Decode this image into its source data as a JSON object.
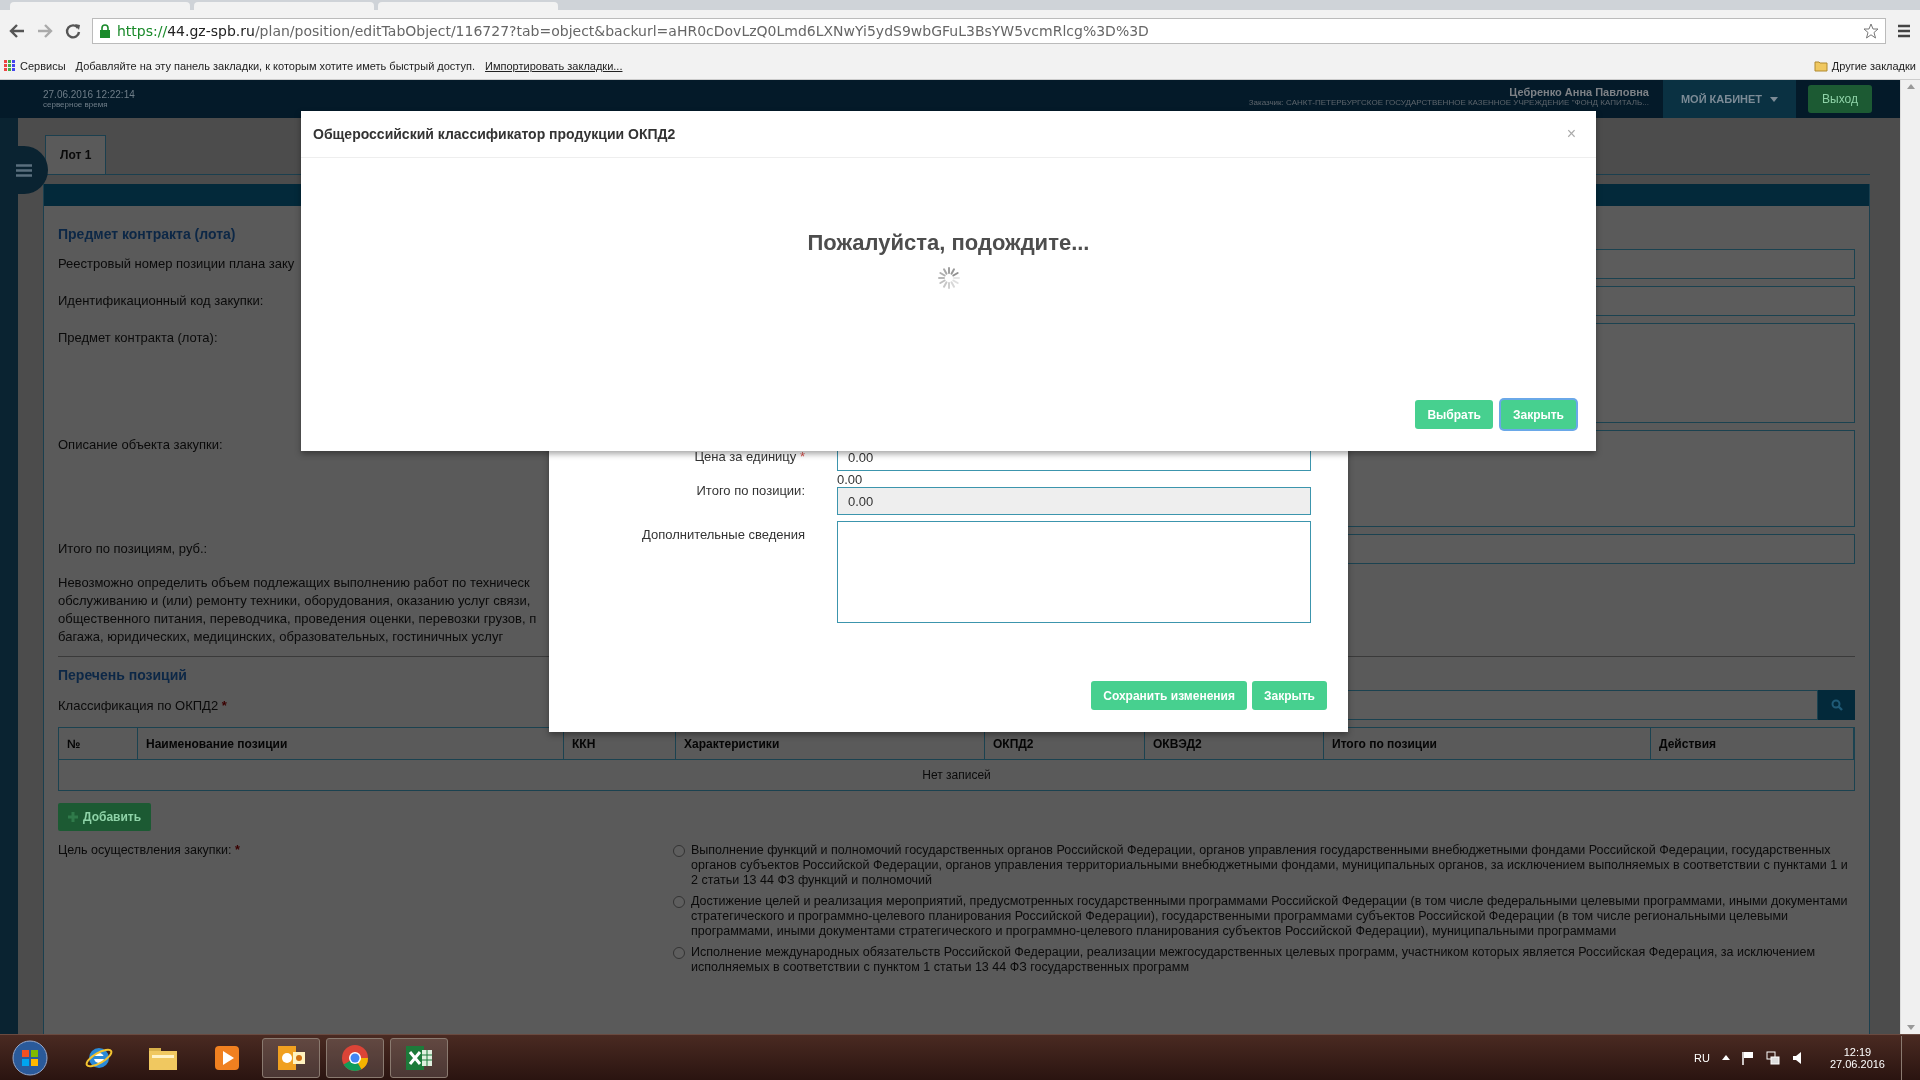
{
  "browser": {
    "url": {
      "scheme": "https://",
      "host": "44.gz-spb.ru",
      "path": "/plan/position/editTabObject/116727?tab=object&backurl=aHR0cDovLzQ0Lmd6LXNwYi5ydS9wbGFuL3BsYW5vcmRlcg%3D%3D"
    }
  },
  "bookmarks_bar": {
    "apps_label": "Сервисы",
    "hint": "Добавляйте на эту панель закладки, к которым хотите иметь быстрый доступ.",
    "import_link": "Импортировать закладки...",
    "other_bookmarks": "Другие закладки"
  },
  "header": {
    "server_time": "27.06.2016 12:22:14",
    "server_time_caption": "серверное время",
    "user": "Цебренко Анна Павловна",
    "customer": "Заказчик: САНКТ-ПЕТЕРБУРГСКОЕ ГОСУДАРСТВЕННОЕ КАЗЕННОЕ УЧРЕЖДЕНИЕ \"ФОНД КАПИТАЛЬ...",
    "cabinet_button": "МОЙ КАБИНЕТ",
    "logout_button": "Выход"
  },
  "tabs": [
    {
      "label": "Лот 1",
      "selected": true
    }
  ],
  "form": {
    "section_title": "Предмет контракта (лота)",
    "fields": [
      {
        "label": "Реестровый номер позиции плана заку",
        "kind": "input"
      },
      {
        "label": "Идентификационный код закупки:",
        "kind": "input"
      },
      {
        "label": "Предмет контракта (лота):",
        "kind": "textarea"
      },
      {
        "label": "Описание объекта закупки:",
        "kind": "textarea"
      },
      {
        "label": "Итого по позициям, руб.:",
        "kind": "input"
      }
    ],
    "note_lines": [
      "Невозможно определить объем подлежащих выполнению работ по техническ",
      "обслуживанию и (или) ремонту техники, оборудования, оказанию услуг связи,",
      "общественного питания, переводчика, проведения оценки, перевозки грузов, п",
      "багажа, юридических, медицинских, образовательных, гостиничных услуг"
    ]
  },
  "positions": {
    "title": "Перечень позиций",
    "classification_label": "Классификация по ОКПД2",
    "required_mark": "*",
    "columns": [
      "№",
      "Наименование позиции",
      "ККН",
      "Характеристики",
      "ОКПД2",
      "ОКВЭД2",
      "Итого по позиции",
      "Действия"
    ],
    "empty_text": "Нет записей",
    "add_button": "Добавить"
  },
  "purpose": {
    "label": "Цель осуществления закупки:",
    "required_mark": "*",
    "options": [
      {
        "text": "Выполнение функций и полномочий государственных органов Российской Федерации, органов управления государственными внебюджетными фондами Российской Федерации, государственных органов субъектов Российской Федерации, органов управления территориальными внебюджетными фондами, муниципальных органов, за исключением выполняемых в соответствии с пунктами 1 и 2 статьи 13 44 ФЗ функций и полномочий",
        "selected": false
      },
      {
        "text": "Достижение целей и реализация мероприятий, предусмотренных государственными программами Российской Федерации (в том числе федеральными целевыми программами, иными документами стратегического и программно-целевого планирования Российской Федерации), государственными программами субъектов Российской Федерации (в том числе региональными целевыми программами, иными документами стратегического и программно-целевого планирования субъектов Российской Федерации), муниципальными программами",
        "selected": false
      },
      {
        "text": "Исполнение международных обязательств Российской Федерации, реализации межгосударственных целевых программ, участником которых является Российская Федерация, за исключением исполняемых в соответствии с пунктом 1 статьи 13 44 ФЗ государственных программ",
        "selected": false
      }
    ]
  },
  "item_modal": {
    "fields": [
      {
        "label": "Цена за единицу",
        "required_mark": "*",
        "kind": "input",
        "value": "0.00",
        "disabled": false
      },
      {
        "label": "Итого по позиции:",
        "kind": "input",
        "caption": "0.00",
        "value": "0.00",
        "disabled": true
      },
      {
        "label": "Дополнительные сведения",
        "kind": "textarea",
        "disabled": false
      }
    ],
    "buttons": [
      "Сохранить изменения",
      "Закрыть"
    ]
  },
  "classifier_modal": {
    "title": "Общероссийский классификатор продукции ОКПД2",
    "close": "×",
    "message": "Пожалуйста, подождите...",
    "buttons": [
      {
        "label": "Выбрать",
        "focused": false
      },
      {
        "label": "Закрыть",
        "focused": true
      }
    ]
  },
  "taskbar": {
    "apps": [
      {
        "kind": "ie",
        "running": false
      },
      {
        "kind": "explorer",
        "running": false
      },
      {
        "kind": "media",
        "running": false
      },
      {
        "kind": "outlook",
        "running": true
      },
      {
        "kind": "chrome",
        "running": true
      },
      {
        "kind": "excel",
        "running": true
      }
    ],
    "language": "RU",
    "time": "12:19",
    "date": "27.06.2016"
  }
}
